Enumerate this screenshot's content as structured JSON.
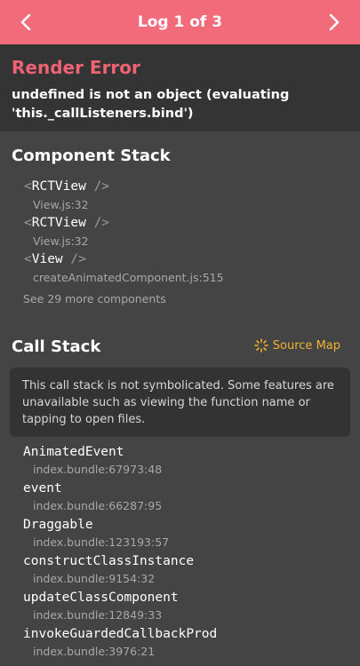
{
  "header": {
    "title": "Log 1 of 3",
    "accent_color": "#f26b7a"
  },
  "error": {
    "title": "Render Error",
    "message": "undefined is not an object (evaluating 'this._callListeners.bind')",
    "title_color": "#ee6272"
  },
  "component_stack": {
    "title": "Component Stack",
    "open_bracket": "<",
    "close_bracket": "/>",
    "items": [
      {
        "name": "RCTView",
        "file": "View.js:32"
      },
      {
        "name": "RCTView",
        "file": "View.js:32"
      },
      {
        "name": "View",
        "file": "createAnimatedComponent.js:515"
      }
    ],
    "see_more": "See 29 more components"
  },
  "call_stack": {
    "title": "Call Stack",
    "source_map_label": "Source Map",
    "source_map_icon": "sun-icon",
    "notice": "This call stack is not symbolicated. Some features are unavailable such as viewing the function name or tapping to open files.",
    "frames": [
      {
        "fn": "AnimatedEvent",
        "loc": "index.bundle:67973:48"
      },
      {
        "fn": "event",
        "loc": "index.bundle:66287:95"
      },
      {
        "fn": "Draggable",
        "loc": "index.bundle:123193:57"
      },
      {
        "fn": "constructClassInstance",
        "loc": "index.bundle:9154:32"
      },
      {
        "fn": "updateClassComponent",
        "loc": "index.bundle:12849:33"
      },
      {
        "fn": "invokeGuardedCallbackProd",
        "loc": "index.bundle:3976:21"
      }
    ]
  }
}
